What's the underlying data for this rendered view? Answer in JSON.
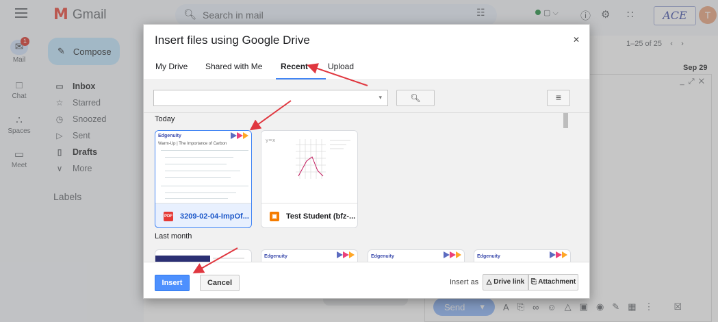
{
  "gmail": {
    "app_name": "Gmail",
    "search_placeholder": "Search in mail",
    "rail": {
      "mail": "Mail",
      "mail_badge": "1",
      "chat": "Chat",
      "spaces": "Spaces",
      "meet": "Meet"
    },
    "compose_label": "Compose",
    "nav": [
      {
        "label": "Inbox",
        "icon": "inbox-icon"
      },
      {
        "label": "Starred",
        "icon": "star-icon"
      },
      {
        "label": "Snoozed",
        "icon": "clock-icon"
      },
      {
        "label": "Sent",
        "icon": "send-icon"
      },
      {
        "label": "Drafts",
        "icon": "draft-icon"
      },
      {
        "label": "More",
        "icon": "chevron-down-icon"
      }
    ],
    "labels_heading": "Labels",
    "pager": "1–25 of 25",
    "first_date": "Sep 29",
    "brand_logo": "ACE",
    "avatar_letter": "T",
    "send_label": "Send"
  },
  "dialog": {
    "title": "Insert files using Google Drive",
    "tabs": [
      "My Drive",
      "Shared with Me",
      "Recent",
      "Upload"
    ],
    "active_tab": "Recent",
    "search_value": "",
    "sections": {
      "today": "Today",
      "last_month": "Last month"
    },
    "files_today": [
      {
        "name": "3209-02-04-ImpOf...",
        "type": "pdf",
        "selected": true,
        "thumb_header": "Edgenuity",
        "thumb_subtitle": "Warm-Up | The Importance of Carbon"
      },
      {
        "name": "Test Student (bfz-...",
        "type": "image",
        "selected": false
      }
    ],
    "files_last_month": [
      {
        "thumb_header": ""
      },
      {
        "thumb_header": "Edgenuity"
      },
      {
        "thumb_header": "Edgenuity"
      },
      {
        "thumb_header": "Edgenuity"
      }
    ],
    "footer": {
      "insert_label": "Insert",
      "cancel_label": "Cancel",
      "insert_as_label": "Insert as",
      "drive_link_label": "Drive link",
      "attachment_label": "Attachment"
    }
  },
  "colors": {
    "accent": "#4285f4",
    "insert_button": "#4d90fe",
    "arrow": "#e0373f"
  }
}
